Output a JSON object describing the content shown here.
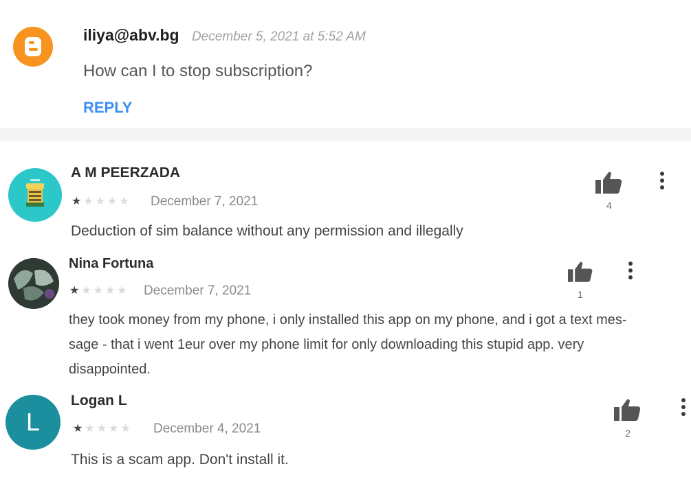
{
  "blogger_comment": {
    "author": "iliya@abv.bg",
    "date": "December 5, 2021 at 5:52 AM",
    "text": "How can I to stop subscription?",
    "reply_label": "REPLY",
    "avatar_color": "#f7931e",
    "avatar_icon": "blogger-logo-icon"
  },
  "reviews": [
    {
      "name": "A M PEERZADA",
      "rating": 1,
      "max_rating": 5,
      "date": "December 7, 2021",
      "text": "Deduction of sim balance without any permission and illegally",
      "helpful_count": "4"
    },
    {
      "name": "Nina Fortuna",
      "rating": 1,
      "max_rating": 5,
      "date": "December 7, 2021",
      "text": "they took money from my phone, i only installed this app on my phone, and i got a text mes-sage - that i went 1eur over my phone limit for only downloading this stupid app. very disappointed.",
      "text_lines": [
        "they took money from my phone, i only installed this app on my phone, and i got a text mes-",
        "sage - that i went 1eur over my phone limit for only downloading this stupid app. very",
        "disappointed."
      ],
      "helpful_count": "1"
    },
    {
      "name": "Logan L",
      "avatar_initial": "L",
      "avatar_color": "#1b8f9d",
      "rating": 1,
      "max_rating": 5,
      "date": "December 4, 2021",
      "text": "This is a scam app. Don't install it.",
      "helpful_count": "2"
    }
  ],
  "icons": {
    "thumb": "thumbs-up-icon",
    "more": "more-vert-icon",
    "star": "star-icon"
  },
  "colors": {
    "reply_link": "#3d8ff0",
    "star_filled": "#444444",
    "star_empty": "#dadada"
  }
}
